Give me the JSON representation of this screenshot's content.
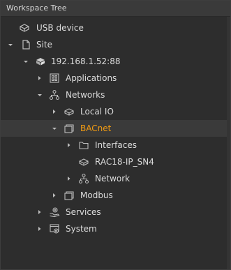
{
  "panel": {
    "title": "Workspace Tree"
  },
  "tree": {
    "usb_device": "USB device",
    "site": "Site",
    "ip": "192.168.1.52:88",
    "applications": "Applications",
    "networks": "Networks",
    "local_io": "Local IO",
    "bacnet": "BACnet",
    "interfaces": "Interfaces",
    "rac": "RAC18-IP_SN4",
    "network": "Network",
    "modbus": "Modbus",
    "services": "Services",
    "system": "System"
  },
  "colors": {
    "accent": "#f39c12",
    "text": "#dcdcdc",
    "icon": "#bdbdbd"
  }
}
